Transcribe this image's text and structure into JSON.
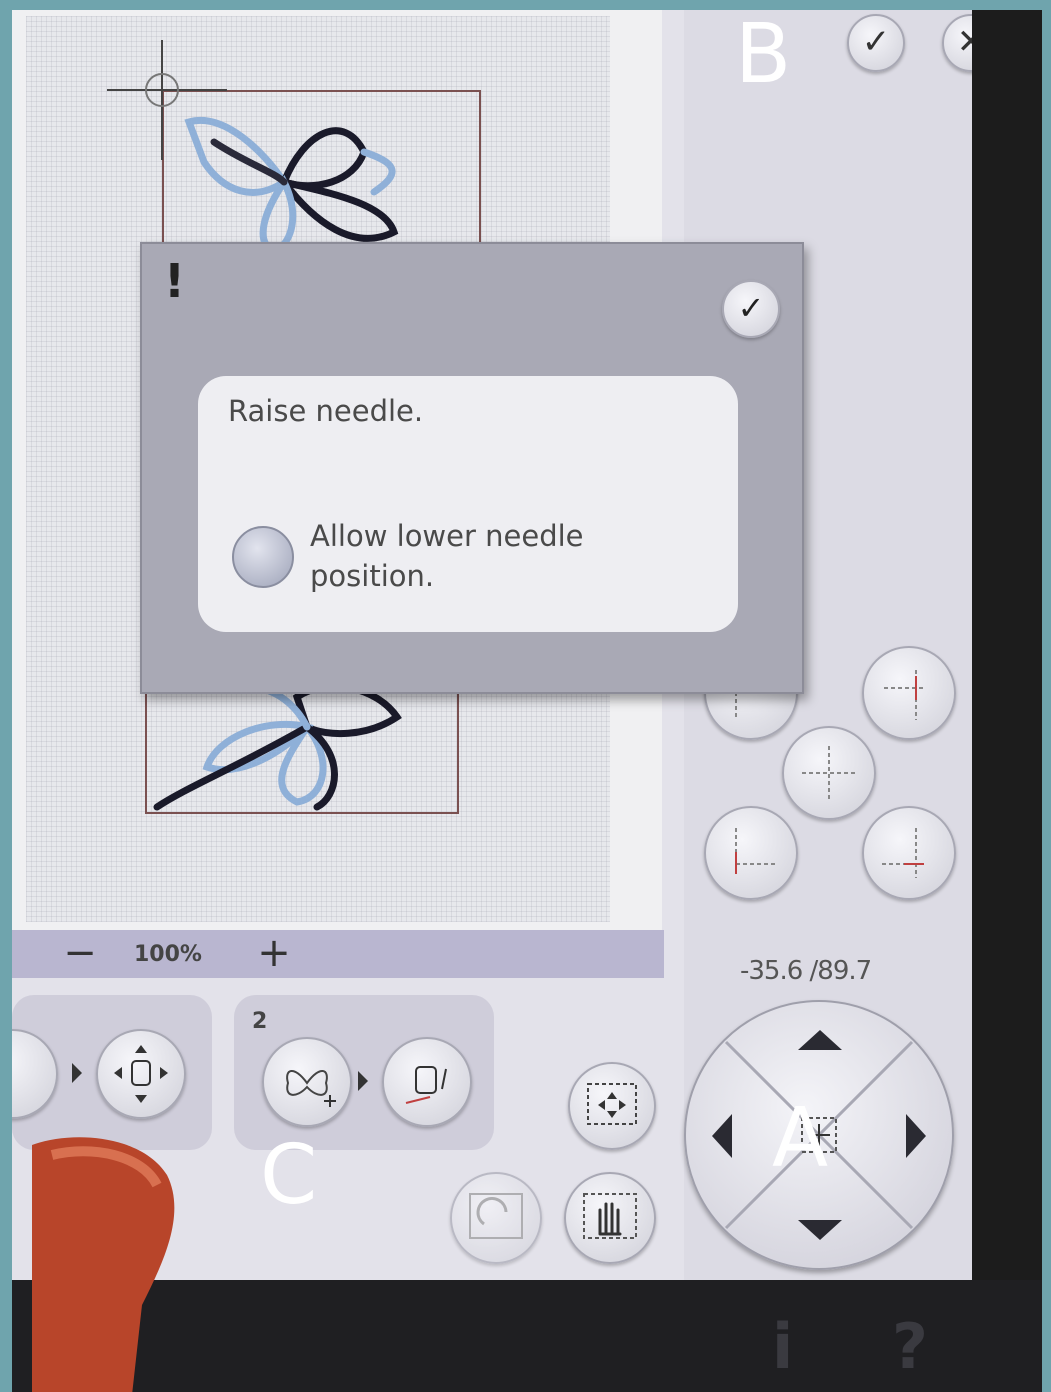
{
  "overlay_letters": {
    "a": "A",
    "b": "B",
    "c": "C"
  },
  "zoom": {
    "level": "100%",
    "out_label": "−",
    "in_label": "+"
  },
  "coordinates": "-35.6 /89.7",
  "top_buttons": {
    "ok": "✓",
    "close": "✕"
  },
  "dialog": {
    "icon": "!",
    "ok": "✓",
    "message": "Raise needle.",
    "checkbox_label": "Allow lower needle position."
  },
  "group2_number": "2",
  "system_icons": {
    "info": "i",
    "help": "?"
  },
  "colors": {
    "background": "#6fa4ad",
    "panel": "#dcdbe4",
    "zoombar": "#b9b6d0",
    "dialog": "#a9a9b5"
  }
}
